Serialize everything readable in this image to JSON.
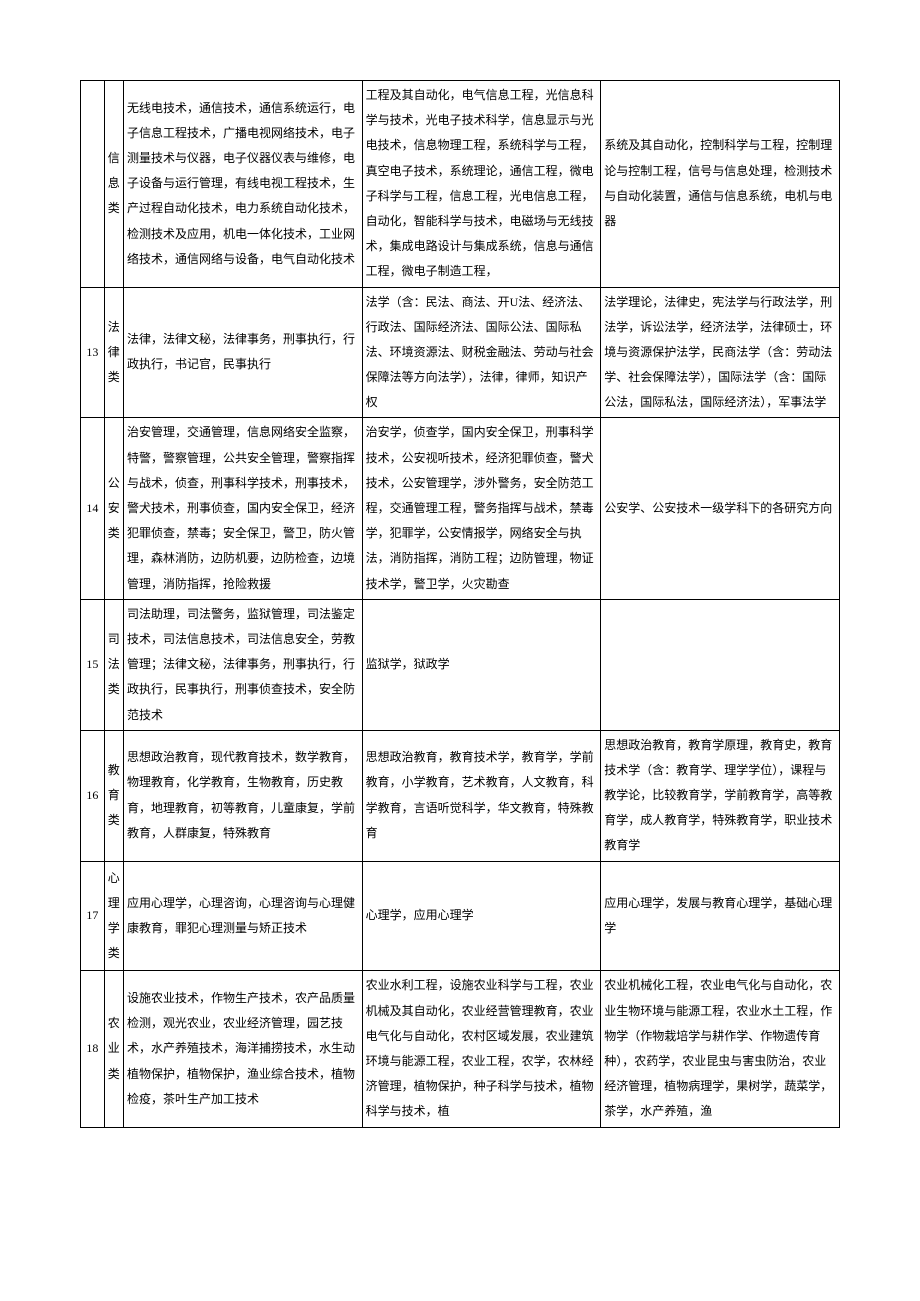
{
  "rows": [
    {
      "num": "",
      "cat": "信息类",
      "a": "无线电技术，通信技术，通信系统运行，电子信息工程技术，广播电视网络技术，电子测量技术与仪器，电子仪器仪表与维修，电子设备与运行管理，有线电视工程技术，生产过程自动化技术，电力系统自动化技术，检测技术及应用，机电一体化技术，工业网络技术，通信网络与设备，电气自动化技术",
      "b": "工程及其自动化，电气信息工程，光信息科学与技术，光电子技术科学，信息显示与光电技术，信息物理工程，系统科学与工程，真空电子技术，系统理论，通信工程，微电子科学与工程，信息工程，光电信息工程，自动化，智能科学与技术，电磁场与无线技术，集成电路设计与集成系统，信息与通信工程，微电子制造工程，",
      "c": "系统及其自动化，控制科学与工程，控制理论与控制工程，信号与信息处理，检测技术与自动化装置，通信与信息系统，电机与电器"
    },
    {
      "num": "13",
      "cat": "法律类",
      "a": "法律，法律文秘，法律事务，刑事执行，行政执行，书记官，民事执行",
      "b": "法学（含：民法、商法、开U法、经济法、行政法、国际经济法、国际公法、国际私法、环境资源法、财税金融法、劳动与社会保障法等方向法学），法律，律师，知识产权",
      "c": "法学理论，法律史，宪法学与行政法学，刑法学，诉讼法学，经济法学，法律硕士，环境与资源保护法学，民商法学（含：劳动法学、社会保障法学），国际法学（含：国际公法，国际私法，国际经济法），军事法学"
    },
    {
      "num": "14",
      "cat": "公安类",
      "a": "治安管理，交通管理，信息网络安全监察，特警，警察管理，公共安全管理，警察指挥与战术，侦查，刑事科学技术，刑事技术，警犬技术，刑事侦查，国内安全保卫，经济犯罪侦查，禁毒；安全保卫，警卫，防火管理，森林消防，边防机要，边防检查，边境管理，消防指挥，抢险救援",
      "b": "治安学，侦查学，国内安全保卫，刑事科学技术，公安视听技术，经济犯罪侦查，警犬技术，公安管理学，涉外警务，安全防范工程，交通管理工程，警务指挥与战术，禁毒学，犯罪学，公安情报学，网络安全与执法，消防指挥，消防工程；边防管理，物证技术学，警卫学，火灾勘查",
      "c": "公安学、公安技术一级学科下的各研究方向"
    },
    {
      "num": "15",
      "cat": "司法类",
      "a": "司法助理，司法警务，监狱管理，司法鉴定技术，司法信息技术，司法信息安全，劳教管理；法律文秘，法律事务，刑事执行，行政执行，民事执行，刑事侦查技术，安全防范技术",
      "b": "监狱学，狱政学",
      "c": ""
    },
    {
      "num": "16",
      "cat": "教育类",
      "a": "思想政治教育，现代教育技术，数学教育，物理教育，化学教育，生物教育，历史教育，地理教育，初等教育，儿童康复，学前教育，人群康复，特殊教育",
      "b": "思想政治教育，教育技术学，教育学，学前教育，小学教育，艺术教育，人文教育，科学教育，言语听觉科学，华文教育，特殊教育",
      "c": "思想政治教育，教育学原理，教育史，教育技术学（含：教育学、理学学位），课程与教学论，比较教育学，学前教育学，高等教育学，成人教育学，特殊教育学，职业技术教育学"
    },
    {
      "num": "17",
      "cat": "心理学类",
      "a": "应用心理学，心理咨询，心理咨询与心理健康教育，罪犯心理测量与矫正技术",
      "b": "心理学，应用心理学",
      "c": "应用心理学，发展与教育心理学，基础心理学"
    },
    {
      "num": "18",
      "cat": "农业类",
      "a": "设施农业技术，作物生产技术，农产品质量检测，观光农业，农业经济管理，园艺技术，水产养殖技术，海洋捕捞技术，水生动植物保护，植物保护，渔业综合技术，植物检疫，茶叶生产加工技术",
      "b": "农业水利工程，设施农业科学与工程，农业机械及其自动化，农业经营管理教育，农业电气化与自动化，农村区域发展，农业建筑环境与能源工程，农业工程，农学，农林经济管理，植物保护，种子科学与技术，植物科学与技术，植",
      "c": "农业机械化工程，农业电气化与自动化，农业生物环境与能源工程，农业水土工程，作物学（作物栽培学与耕作学、作物遗传育种），农药学，农业昆虫与害虫防治，农业经济管理，植物病理学，果树学，蔬菜学，茶学，水产养殖，渔"
    }
  ]
}
